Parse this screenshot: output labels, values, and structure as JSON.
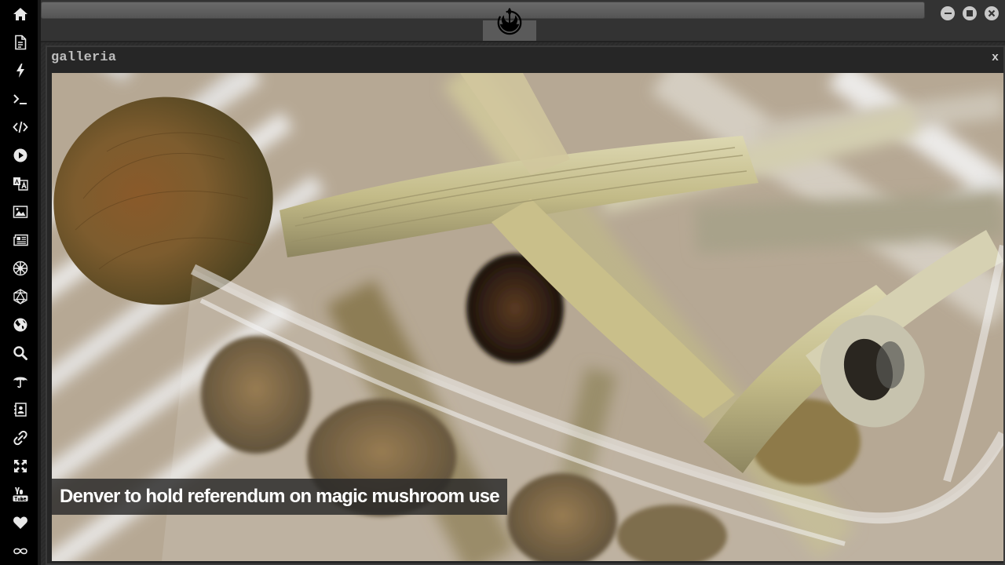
{
  "sidebar": {
    "items": [
      {
        "icon": "home-icon",
        "label": "home"
      },
      {
        "icon": "document-icon",
        "label": "document"
      },
      {
        "icon": "lightning-icon",
        "label": "lightning"
      },
      {
        "icon": "terminal-icon",
        "label": "terminal"
      },
      {
        "icon": "code-icon",
        "label": "code"
      },
      {
        "icon": "play-icon",
        "label": "play"
      },
      {
        "icon": "translate-icon",
        "label": "translate"
      },
      {
        "icon": "image-icon",
        "label": "image"
      },
      {
        "icon": "newspaper-icon",
        "label": "newspaper"
      },
      {
        "icon": "galactic-empire-icon",
        "label": "galactic-empire"
      },
      {
        "icon": "d20-icon",
        "label": "d20"
      },
      {
        "icon": "globe-icon",
        "label": "globe"
      },
      {
        "icon": "search-icon",
        "label": "search"
      },
      {
        "icon": "umbrella-icon",
        "label": "umbrella"
      },
      {
        "icon": "contact-book-icon",
        "label": "contacts"
      },
      {
        "icon": "link-icon",
        "label": "link"
      },
      {
        "icon": "fullscreen-icon",
        "label": "fullscreen"
      },
      {
        "icon": "youtube-icon",
        "label": "youtube"
      },
      {
        "icon": "heart-icon",
        "label": "heart"
      },
      {
        "icon": "infinity-cloud-icon",
        "label": "cloud"
      }
    ]
  },
  "topbar": {
    "logo_icon": "rebel-alliance-icon",
    "window_controls": [
      "minimize-icon",
      "maximize-icon",
      "close-icon"
    ]
  },
  "gallery": {
    "title": "galleria",
    "close_label": "x",
    "caption": "Denver to hold referendum on magic mushroom use"
  },
  "colors": {
    "sidebar_bg": "#000000",
    "topbar_bg": "#333333",
    "window_bg": "#262626",
    "caption_bg": "#282828"
  }
}
